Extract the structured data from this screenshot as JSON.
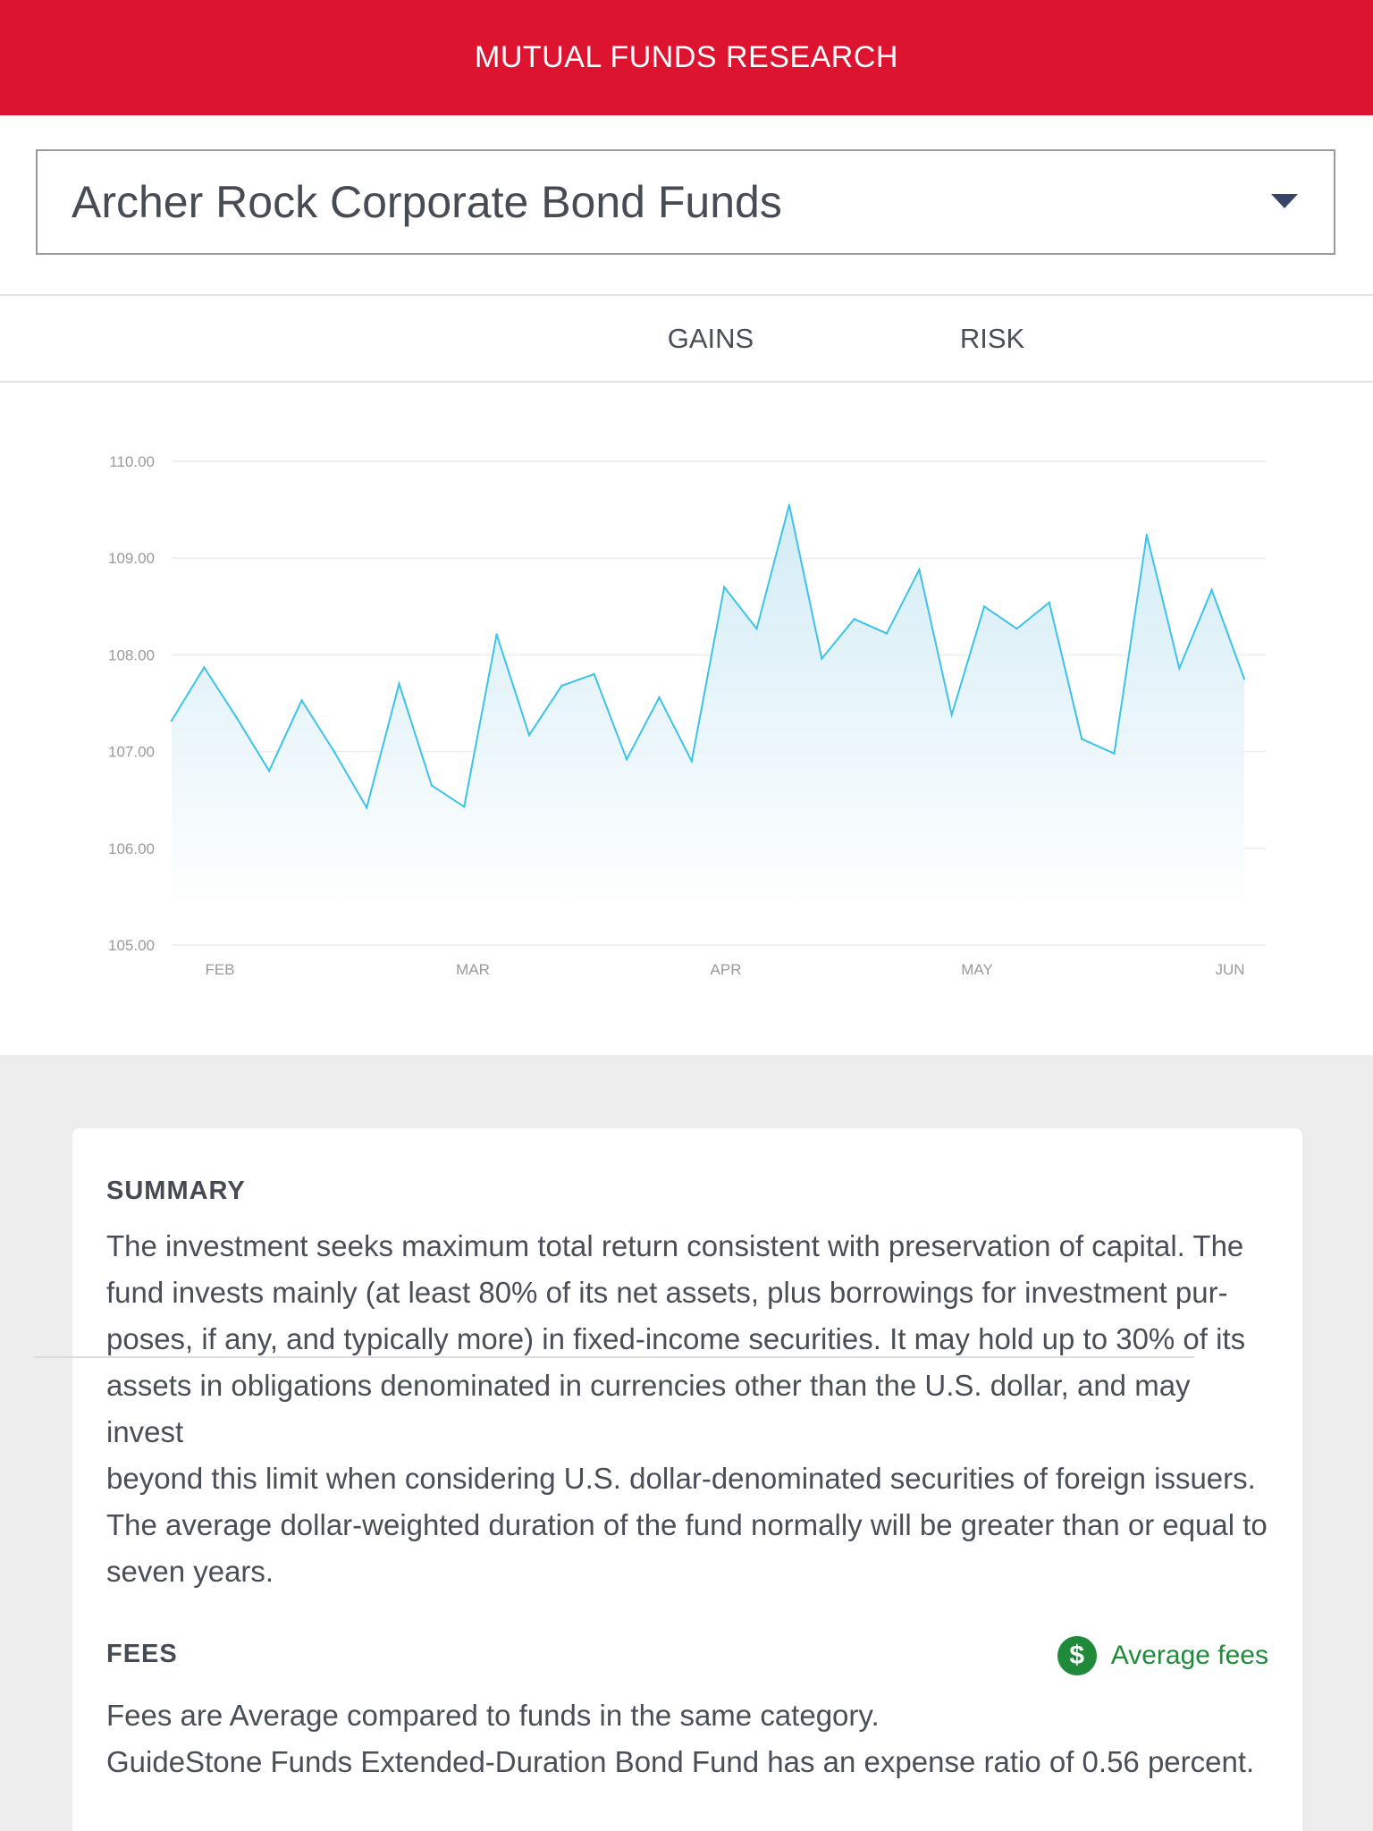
{
  "header": {
    "title": "MUTUAL FUNDS RESEARCH"
  },
  "fund_select": {
    "value": "Archer Rock Corporate Bond Funds",
    "icon": "caret-down-icon"
  },
  "tabs": [
    {
      "label": "GAINS"
    },
    {
      "label": "RISK"
    }
  ],
  "chart_data": {
    "type": "area",
    "title": "",
    "xlabel": "",
    "ylabel": "",
    "ylim": [
      105,
      110
    ],
    "y_ticks": [
      "110.00",
      "109.00",
      "108.00",
      "107.00",
      "106.00",
      "105.00"
    ],
    "x_ticks": [
      "FEB",
      "MAR",
      "APR",
      "MAY",
      "JUN"
    ],
    "grid": true,
    "colors": {
      "line": "#3cc3ea",
      "fill": "#d6eef7"
    },
    "series": [
      {
        "values": [
          107.32,
          107.87,
          107.35,
          106.8,
          107.53,
          107.0,
          106.42,
          107.7,
          106.65,
          106.43,
          108.21,
          107.17,
          107.68,
          107.8,
          106.92,
          107.56,
          106.9,
          108.7,
          108.27,
          109.55,
          107.96,
          108.37,
          108.22,
          108.88,
          107.38,
          108.5,
          108.27,
          108.54,
          107.13,
          106.98,
          109.24,
          107.86,
          108.67,
          107.75
        ]
      }
    ]
  },
  "summary": {
    "title": "SUMMARY",
    "lines": [
      "The investment seeks maximum total return consistent with preservation of capital. The",
      "fund invests mainly (at least 80% of its net assets, plus borrowings for investment pur-",
      "poses, if any, and typically more) in fixed-income securities. It may hold up to 30% of its",
      "assets in obligations denominated in currencies other than the U.S. dollar, and may invest",
      "beyond this limit when considering U.S. dollar-denominated securities of foreign issuers.",
      "The average dollar-weighted duration of the fund normally will be greater than or equal to",
      "seven years."
    ]
  },
  "fees": {
    "title": "FEES",
    "badge_label": "Average fees",
    "badge_icon": "dollar-icon",
    "badge_symbol": "$",
    "badge_color": "#1f8a3a",
    "line1": "Fees are Average compared to funds in the same category.",
    "line2": "GuideStone Funds Extended-Duration Bond Fund has an expense ratio of 0.56 percent."
  }
}
